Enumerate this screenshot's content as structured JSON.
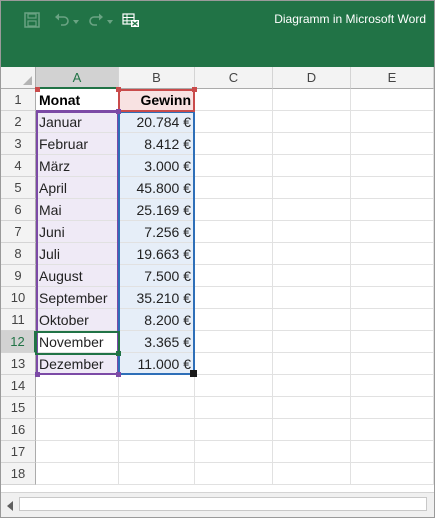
{
  "window": {
    "title": "Diagramm in Microsoft Word"
  },
  "toolbar": {
    "save_icon": "save-icon",
    "undo_icon": "undo-icon",
    "redo_icon": "redo-icon",
    "edit_data_icon": "edit-data-in-excel-icon"
  },
  "colors": {
    "brand": "#217346",
    "series_names_border": "#c94b4b",
    "categories_border": "#7c4aa6",
    "values_border": "#2e6fb8"
  },
  "columns": [
    "A",
    "B",
    "C",
    "D",
    "E"
  ],
  "rows": [
    "1",
    "2",
    "3",
    "4",
    "5",
    "6",
    "7",
    "8",
    "9",
    "10",
    "11",
    "12",
    "13",
    "14",
    "15",
    "16",
    "17",
    "18"
  ],
  "table": {
    "headers": {
      "a": "Monat",
      "b": "Gewinn"
    },
    "months": [
      "Januar",
      "Februar",
      "März",
      "April",
      "Mai",
      "Juni",
      "Juli",
      "August",
      "September",
      "Oktober",
      "November",
      "Dezember"
    ],
    "values": [
      "20.784 €",
      "8.412 €",
      "3.000 €",
      "45.800 €",
      "25.169 €",
      "7.256 €",
      "19.663 €",
      "7.500 €",
      "35.210 €",
      "8.200 €",
      "3.365 €",
      "11.000 €"
    ]
  },
  "active_cell": "A12"
}
